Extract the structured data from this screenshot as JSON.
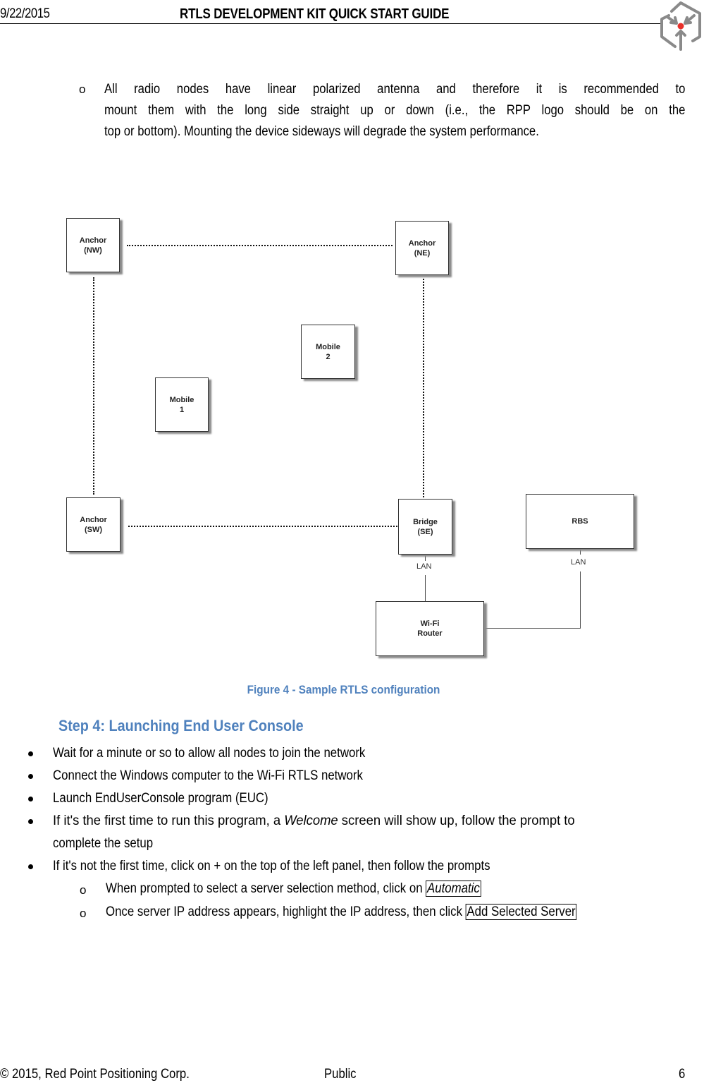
{
  "header": {
    "date": "9/22/2015",
    "title": "RTLS DEVELOPMENT KIT QUICK START GUIDE",
    "logo_icon": "red-point-positioning-logo-icon",
    "logo_accent_color": "#e8302a",
    "logo_stroke_color": "#8a8a8a"
  },
  "intro_bullet": {
    "marker": "o",
    "lines": [
      "All radio nodes have linear polarized antenna and therefore it is recommended to",
      "mount them with the long side straight up or down (i.e., the RPP logo should be on the",
      "top or bottom). Mounting the device sideways will degrade the system performance."
    ]
  },
  "diagram": {
    "nodes": [
      {
        "id": "anchor-nw",
        "line1": "Anchor",
        "line2": "(NW)"
      },
      {
        "id": "anchor-ne",
        "line1": "Anchor",
        "line2": "(NE)"
      },
      {
        "id": "mobile-2",
        "line1": "Mobile",
        "line2": "2"
      },
      {
        "id": "mobile-1",
        "line1": "Mobile",
        "line2": "1"
      },
      {
        "id": "anchor-sw",
        "line1": "Anchor",
        "line2": "(SW)"
      },
      {
        "id": "bridge-se",
        "line1": "Bridge",
        "line2": "(SE)"
      },
      {
        "id": "rbs",
        "line1": "RBS",
        "line2": ""
      },
      {
        "id": "wifi-router",
        "line1": "Wi-Fi",
        "line2": "Router"
      }
    ],
    "link_labels": [
      "LAN",
      "LAN"
    ]
  },
  "figure_caption": "Figure 4 - Sample RTLS configuration",
  "step": {
    "heading": "Step 4: Launching End User Console",
    "heading_color": "#4f81bd",
    "bullets": [
      "Wait for a minute or so to allow all nodes to join the network",
      "Connect the Windows computer to the Wi-Fi RTLS network",
      "Launch EndUserConsole program (EUC)"
    ],
    "bullet4": {
      "before": "If it's the first time to run this program, a ",
      "italic": "Welcome",
      "after": " screen will show up, follow the prompt to",
      "line2": "complete the setup"
    },
    "bullet5": "If it's not the first time, click on + on the top of the left panel, then follow the prompts",
    "sub_bullets": [
      {
        "text": "When prompted to select a server selection method, click on ",
        "button": "Automatic"
      },
      {
        "text": "Once server IP address appears, highlight the IP address, then click ",
        "button": "Add Selected Server"
      }
    ]
  },
  "footer": {
    "copyright": "© 2015, Red Point Positioning Corp.",
    "classification": "Public",
    "page_number": "6"
  }
}
